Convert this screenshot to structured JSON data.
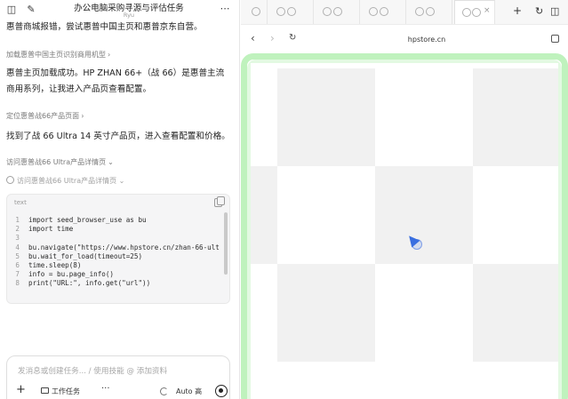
{
  "window": {
    "title": "办公电脑采购寻源与评估任务",
    "subtitle": "Ryu"
  },
  "chat": {
    "messages": [
      "惠普商城报错，尝试惠普中国主页和惠普京东自营。",
      "惠普主页加载成功。HP ZHAN 66+（战 66）是惠普主流商用系列，让我进入产品页查看配置。",
      "找到了战 66 Ultra 14 英寸产品页，进入查看配置和价格。"
    ],
    "steps": [
      "加载惠普中国主页识别商用机型",
      "定位惠普战66产品页面",
      "访问惠普战66 Ultra产品详情页",
      "访问惠普战66 Ultra产品详情页"
    ],
    "code": {
      "lang": "text",
      "lines": [
        {
          "n": "1",
          "t": "import seed_browser_use as bu"
        },
        {
          "n": "2",
          "t": "import time"
        },
        {
          "n": "3",
          "t": ""
        },
        {
          "n": "4",
          "t": "bu.navigate(\"https://www.hpstore.cn/zhan-66-ult"
        },
        {
          "n": "5",
          "t": "bu.wait_for_load(timeout=25)"
        },
        {
          "n": "6",
          "t": "time.sleep(8)"
        },
        {
          "n": "7",
          "t": "info = bu.page_info()"
        },
        {
          "n": "8",
          "t": "print(\"URL:\", info.get(\"url\"))"
        }
      ]
    },
    "input": {
      "placeholder": "发消息或创建任务... / 使用技能 @ 添加资料",
      "task_label": "工作任务",
      "more_label": "···",
      "auto_label": "Auto 高",
      "plus_label": "+"
    }
  },
  "browser": {
    "url": "hpstore.cn",
    "tab_plus": "+",
    "tab_close": "×",
    "nav_back": "‹",
    "nav_forward": "›",
    "nav_reload": "↻",
    "accent": "#bff2bd",
    "cursor_color": "#3a6fe0"
  }
}
